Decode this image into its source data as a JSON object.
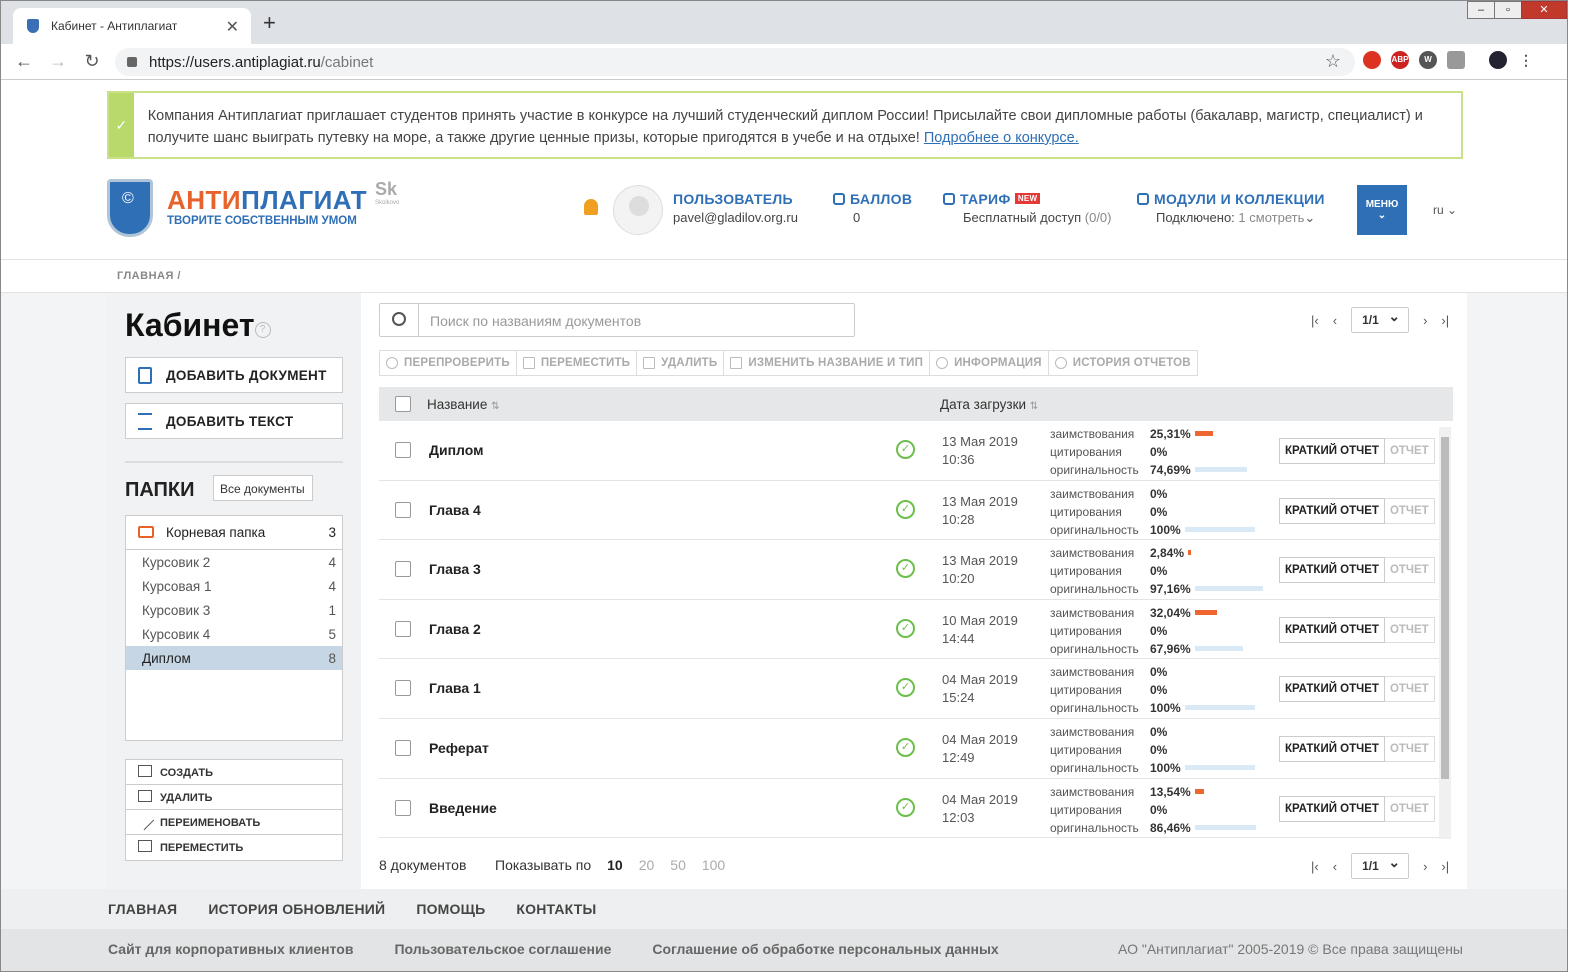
{
  "browser": {
    "tab_title": "Кабинет - Антиплагиат",
    "url_host": "https://users.antiplagiat.ru",
    "url_path": "/cabinet",
    "newtab": "+",
    "close": "✕"
  },
  "banner": {
    "text": "Компания Антиплагиат приглашает студентов принять участие в конкурсе на лучший студенческий диплом России! Присылайте свои дипломные работы (бакалавр, магистр, специалист) и получите шанс выиграть путевку на море, а также другие ценные призы, которые пригодятся в учебе и на отдыхе! ",
    "link": "Подробнее о конкурсе.",
    "check": "✓"
  },
  "logo": {
    "brand_a": "АНТИ",
    "brand_b": "ПЛАГИАТ",
    "slogan": "ТВОРИТЕ СОБСТВЕННЫМ УМОМ",
    "sk": "Sk",
    "sk_small": "Skolkovo"
  },
  "header": {
    "user": {
      "title": "ПОЛЬЗОВАТЕЛЬ",
      "email": "pavel@gladilov.org.ru"
    },
    "points": {
      "title": "БАЛЛОВ",
      "value": "0"
    },
    "tariff": {
      "title": "ТАРИФ",
      "badge": "NEW",
      "value": "Бесплатный доступ",
      "count": "(0/0)"
    },
    "modules": {
      "title": "МОДУЛИ И КОЛЛЕКЦИИ",
      "connected": "Подключено:",
      "num": "1",
      "view": "смотреть"
    },
    "menu": "МЕНЮ",
    "lang": "ru"
  },
  "breadcrumb": "ГЛАВНАЯ /",
  "sidebar": {
    "title": "Кабинет",
    "help": "?",
    "add_doc": "ДОБАВИТЬ ДОКУМЕНТ",
    "add_text": "ДОБАВИТЬ ТЕКСТ",
    "folders_title": "ПАПКИ",
    "all_docs": "Все документы",
    "root": {
      "name": "Корневая папка",
      "count": "3"
    },
    "folders": [
      {
        "name": "Курсовик 2",
        "count": "4"
      },
      {
        "name": "Курсовая 1",
        "count": "4"
      },
      {
        "name": "Курсовик 3",
        "count": "1"
      },
      {
        "name": "Курсовик 4",
        "count": "5"
      },
      {
        "name": "Диплом",
        "count": "8"
      }
    ],
    "actions": [
      "СОЗДАТЬ",
      "УДАЛИТЬ",
      "ПЕРЕИМЕНОВАТЬ",
      "ПЕРЕМЕСТИТЬ"
    ]
  },
  "search": {
    "placeholder": "Поиск по названиям документов"
  },
  "pager": {
    "value": "1/1"
  },
  "toolbar": [
    "ПЕРЕПРОВЕРИТЬ",
    "ПЕРЕМЕСТИТЬ",
    "УДАЛИТЬ",
    "ИЗМЕНИТЬ НАЗВАНИЕ И ТИП",
    "ИНФОРМАЦИЯ",
    "ИСТОРИЯ ОТЧЕТОВ"
  ],
  "table": {
    "col_name": "Название",
    "col_date": "Дата загрузки",
    "labels": {
      "borrow": "заимствования",
      "cite": "цитирования",
      "orig": "оригинальность"
    },
    "btn_short": "КРАТКИЙ ОТЧЕТ",
    "btn_full": "ОТЧЕТ",
    "ok": "✓",
    "rows": [
      {
        "name": "Диплом",
        "date": "13 Мая 2019",
        "time": "10:36",
        "borrow": "25,31%",
        "cite": "0%",
        "orig": "74,69%",
        "borrow_frac": 0.2531,
        "orig_frac": 0.7469
      },
      {
        "name": "Глава 4",
        "date": "13 Мая 2019",
        "time": "10:28",
        "borrow": "0%",
        "cite": "0%",
        "orig": "100%",
        "borrow_frac": 0,
        "orig_frac": 1
      },
      {
        "name": "Глава 3",
        "date": "13 Мая 2019",
        "time": "10:20",
        "borrow": "2,84%",
        "cite": "0%",
        "orig": "97,16%",
        "borrow_frac": 0.0284,
        "orig_frac": 0.9716
      },
      {
        "name": "Глава 2",
        "date": "10 Мая 2019",
        "time": "14:44",
        "borrow": "32,04%",
        "cite": "0%",
        "orig": "67,96%",
        "borrow_frac": 0.3204,
        "orig_frac": 0.6796
      },
      {
        "name": "Глава 1",
        "date": "04 Мая 2019",
        "time": "15:24",
        "borrow": "0%",
        "cite": "0%",
        "orig": "100%",
        "borrow_frac": 0,
        "orig_frac": 1
      },
      {
        "name": "Реферат",
        "date": "04 Мая 2019",
        "time": "12:49",
        "borrow": "0%",
        "cite": "0%",
        "orig": "100%",
        "borrow_frac": 0,
        "orig_frac": 1
      },
      {
        "name": "Введение",
        "date": "04 Мая 2019",
        "time": "12:03",
        "borrow": "13,54%",
        "cite": "0%",
        "orig": "86,46%",
        "borrow_frac": 0.1354,
        "orig_frac": 0.8646
      }
    ]
  },
  "footer_table": {
    "count": "8 документов",
    "show_by": "Показывать по",
    "sizes": [
      "10",
      "20",
      "50",
      "100"
    ]
  },
  "footer": {
    "nav": [
      "ГЛАВНАЯ",
      "ИСТОРИЯ ОБНОВЛЕНИЙ",
      "ПОМОЩЬ",
      "КОНТАКТЫ"
    ],
    "links": [
      "Сайт для корпоративных клиентов",
      "Пользовательское соглашение",
      "Соглашение об обработке персональных данных"
    ],
    "copyright": "АО \"Антиплагиат\" 2005-2019 © Все права защищены"
  }
}
